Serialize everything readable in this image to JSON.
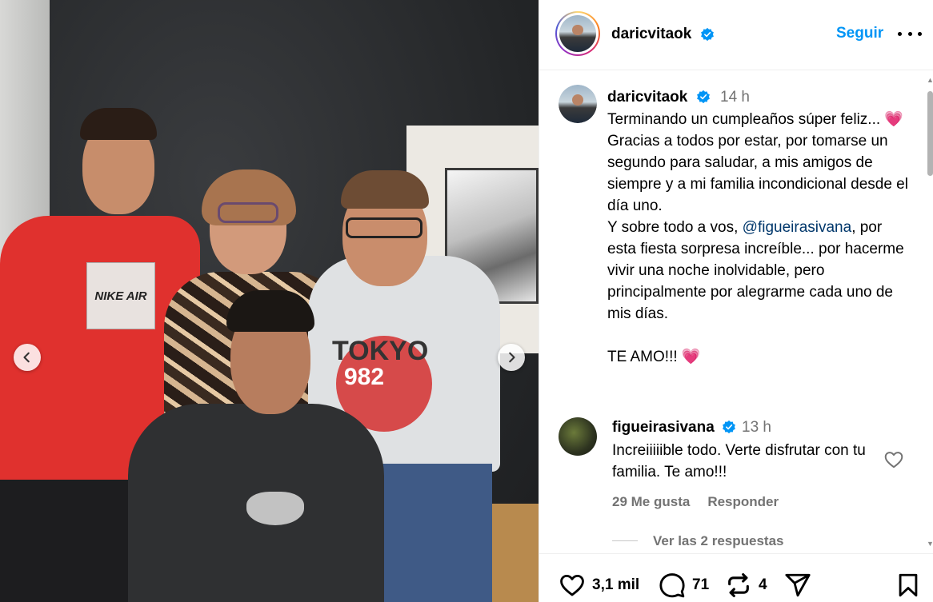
{
  "post": {
    "author": "daricvitaok",
    "follow_label": "Seguir",
    "caption": {
      "username": "daricvitaok",
      "time": "14 h",
      "line1": "Terminando un cumpleaños súper feliz... ",
      "heart1": "💗",
      "line2": "Gracias a todos por estar, por tomarse un segundo para saludar, a mis amigos de siempre y a mi familia incondicional desde el día uno.",
      "line3_pre": "Y sobre todo a vos, ",
      "mention": "@figueirasivana",
      "line3_post": ", por esta fiesta sorpresa increíble... por hacerme vivir una noche inolvidable, pero principalmente por alegrarme cada uno de mis días.",
      "line4": "TE AMO!!! ",
      "heart2": "💗"
    },
    "comment": {
      "username": "figueirasivana",
      "time": "13 h",
      "text": "Increiiiiible todo. Verte disfrutar con tu familia. Te amo!!!",
      "likes_label": "29 Me gusta",
      "reply_label": "Responder",
      "view_replies": "Ver las 2 respuestas"
    },
    "actions": {
      "likes": "3,1 mil",
      "comments": "71",
      "reposts": "4"
    },
    "photo_text": {
      "shirt1": "NIKE AIR",
      "shirt2": "TOKYO",
      "shirt2_num": "982"
    }
  },
  "icons": [
    "verified-badge-icon",
    "more-options-icon",
    "heart-icon",
    "comment-icon",
    "repost-icon",
    "share-icon",
    "save-icon",
    "prev-arrow-icon",
    "next-arrow-icon"
  ],
  "colors": {
    "accent": "#0095f6",
    "verified": "#0095f6",
    "heart": "#e8345b",
    "mention": "#00376b"
  }
}
